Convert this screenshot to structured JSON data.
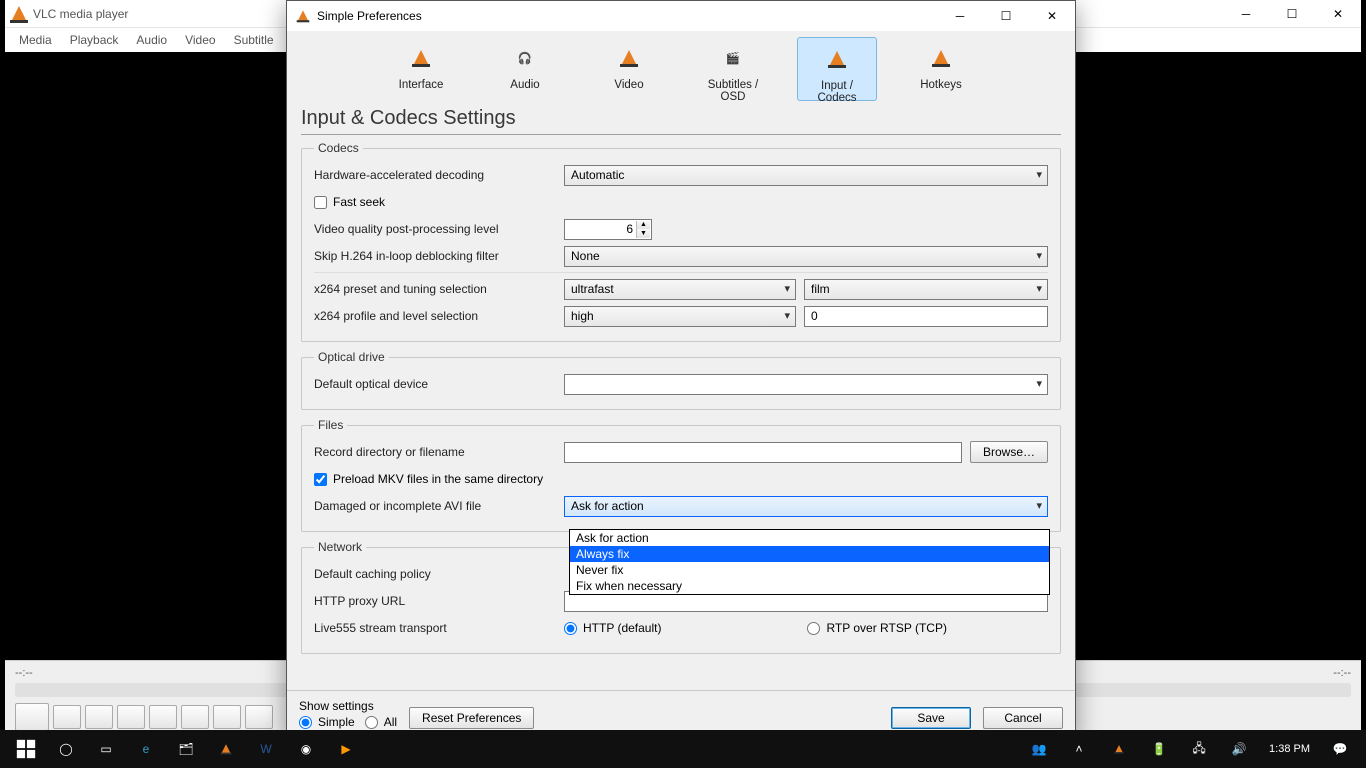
{
  "vlc": {
    "title": "VLC media player",
    "menu": [
      "Media",
      "Playback",
      "Audio",
      "Video",
      "Subtitle"
    ],
    "time_left": "--:--",
    "time_right": "--:--"
  },
  "dialog": {
    "title": "Simple Preferences",
    "tabs": [
      "Interface",
      "Audio",
      "Video",
      "Subtitles / OSD",
      "Input / Codecs",
      "Hotkeys"
    ],
    "section_title": "Input & Codecs Settings",
    "groups": {
      "codecs": {
        "legend": "Codecs",
        "hw_decode_label": "Hardware-accelerated decoding",
        "hw_decode_value": "Automatic",
        "fast_seek_label": "Fast seek",
        "postproc_label": "Video quality post-processing level",
        "postproc_value": "6",
        "skip_h264_label": "Skip H.264 in-loop deblocking filter",
        "skip_h264_value": "None",
        "x264_preset_label": "x264 preset and tuning selection",
        "x264_preset_value": "ultrafast",
        "x264_tuning_value": "film",
        "x264_profile_label": "x264 profile and level selection",
        "x264_profile_value": "high",
        "x264_level_value": "0"
      },
      "optical": {
        "legend": "Optical drive",
        "default_device_label": "Default optical device"
      },
      "files": {
        "legend": "Files",
        "record_label": "Record directory or filename",
        "browse_label": "Browse…",
        "preload_label": "Preload MKV files in the same directory",
        "avi_label": "Damaged or incomplete AVI file",
        "avi_value": "Ask for action",
        "avi_options": [
          "Ask for action",
          "Always fix",
          "Never fix",
          "Fix when necessary"
        ]
      },
      "network": {
        "legend": "Network",
        "cache_label": "Default caching policy",
        "proxy_label": "HTTP proxy URL",
        "live555_label": "Live555 stream transport",
        "transport_http": "HTTP (default)",
        "transport_rtp": "RTP over RTSP (TCP)"
      }
    },
    "footer": {
      "show_label": "Show settings",
      "simple": "Simple",
      "all": "All",
      "reset": "Reset Preferences",
      "save": "Save",
      "cancel": "Cancel"
    }
  },
  "taskbar": {
    "time": "1:38 PM"
  }
}
